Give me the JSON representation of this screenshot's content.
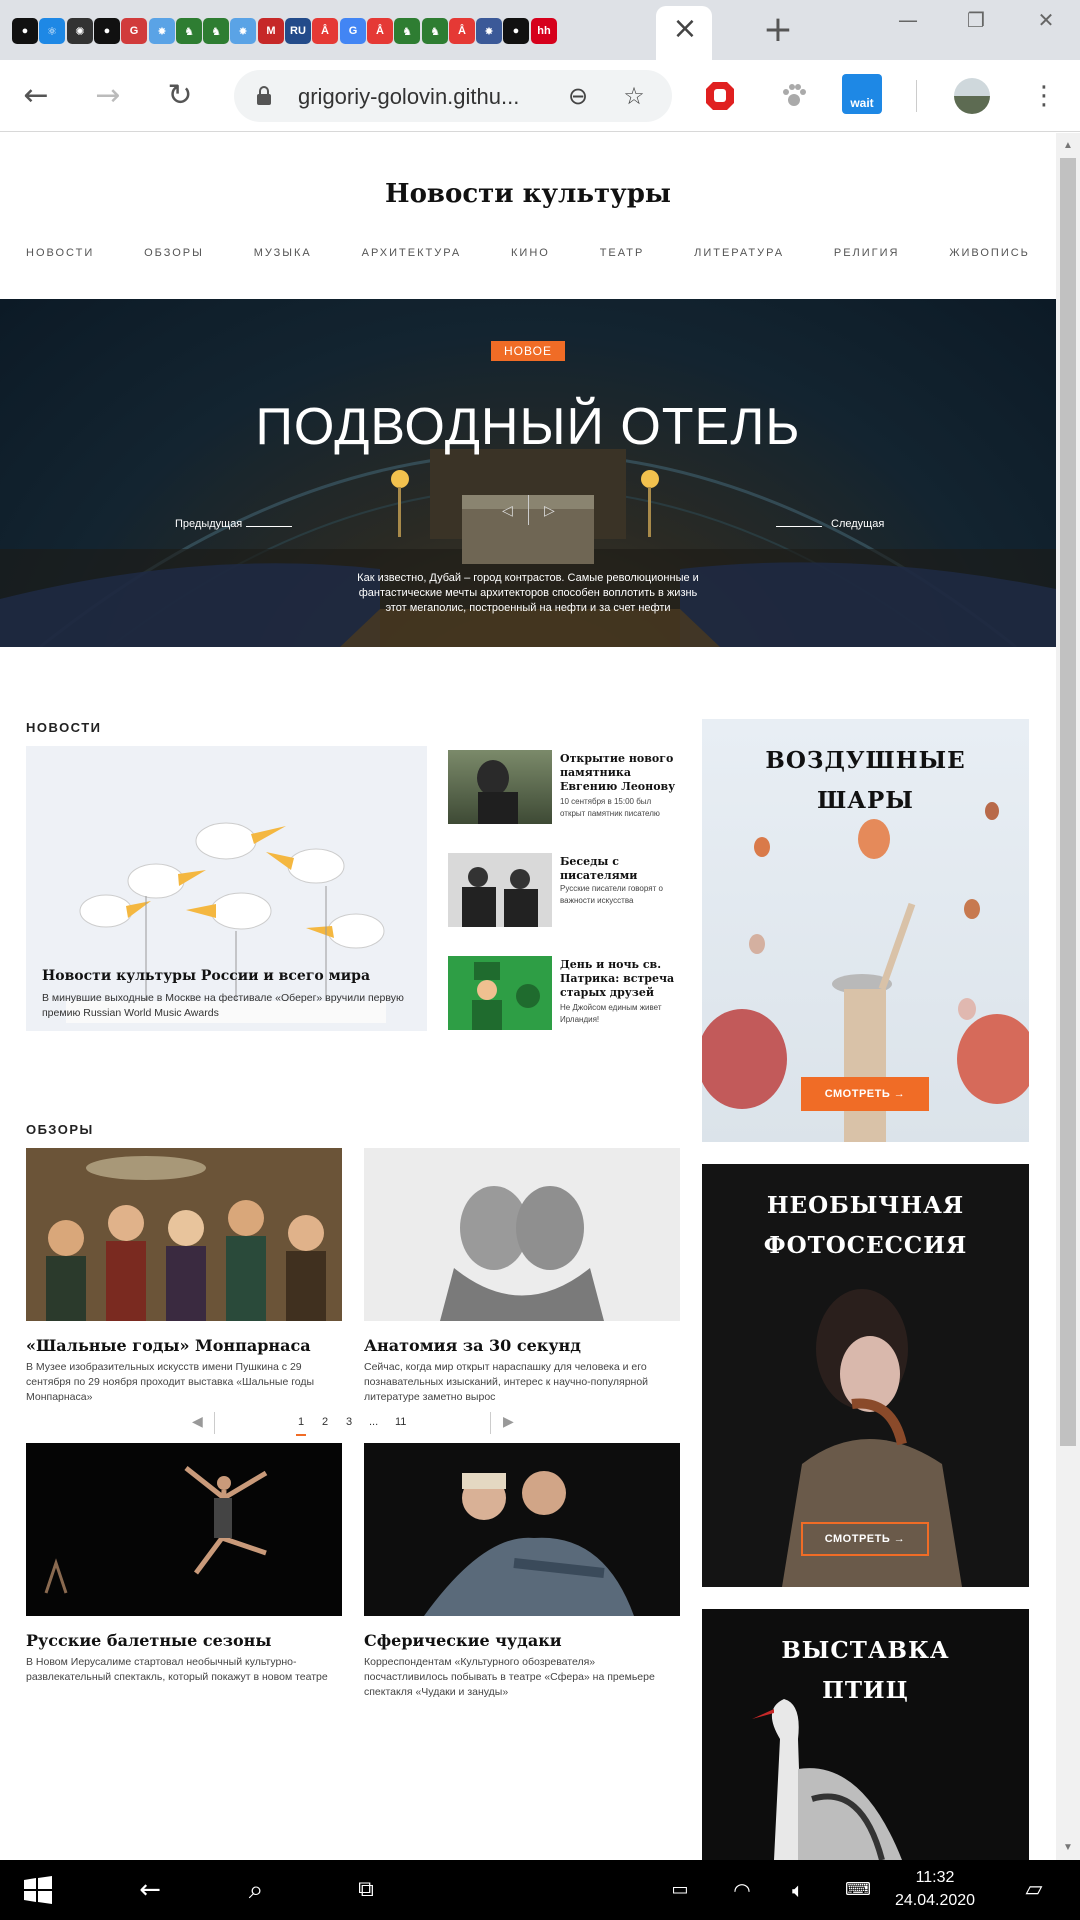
{
  "browser": {
    "tabs": [
      {
        "icon": "github-icon",
        "color": "#111111",
        "glyph": "●"
      },
      {
        "icon": "react-icon",
        "color": "#1e88e5",
        "glyph": "⚛"
      },
      {
        "icon": "openai-icon",
        "color": "#333333",
        "glyph": "✺"
      },
      {
        "icon": "github-icon",
        "color": "#111111",
        "glyph": "●"
      },
      {
        "icon": "gulp-icon",
        "color": "#d13b3b",
        "glyph": "G"
      },
      {
        "icon": "burst-icon",
        "color": "#5aa3e6",
        "glyph": "✸"
      },
      {
        "icon": "android-icon",
        "color": "#2e7d32",
        "glyph": "♞"
      },
      {
        "icon": "android-icon",
        "color": "#2e7d32",
        "glyph": "♞"
      },
      {
        "icon": "burst-icon",
        "color": "#5aa3e6",
        "glyph": "✸"
      },
      {
        "icon": "gmail-icon",
        "color": "#c62828",
        "glyph": "M"
      },
      {
        "icon": "ru-icon",
        "color": "#234b8a",
        "glyph": "RU"
      },
      {
        "icon": "tower-icon",
        "color": "#e53935",
        "glyph": "Å"
      },
      {
        "icon": "translate-icon",
        "color": "#4285f4",
        "glyph": "G"
      },
      {
        "icon": "tower-icon",
        "color": "#e53935",
        "glyph": "Å"
      },
      {
        "icon": "android-icon",
        "color": "#2e7d32",
        "glyph": "♞"
      },
      {
        "icon": "android-icon",
        "color": "#2e7d32",
        "glyph": "♞"
      },
      {
        "icon": "tower-icon",
        "color": "#e53935",
        "glyph": "Å"
      },
      {
        "icon": "burst-icon",
        "color": "#3b5998",
        "glyph": "✸"
      },
      {
        "icon": "github-icon",
        "color": "#111111",
        "glyph": "●"
      },
      {
        "icon": "hh-icon",
        "color": "#d6001c",
        "glyph": "hh"
      }
    ],
    "url": "grigoriy-golovin.githu...",
    "ext_wait_label": "wait"
  },
  "site": {
    "title": "Новости культуры",
    "nav": [
      "НОВОСТИ",
      "ОБЗОРЫ",
      "МУЗЫКА",
      "АРХИТЕКТУРА",
      "КИНО",
      "ТЕАТР",
      "ЛИТЕРАТУРА",
      "РЕЛИГИЯ",
      "ЖИВОПИСЬ"
    ]
  },
  "hero": {
    "badge": "НОВОЕ",
    "title": "ПОДВОДНЫЙ ОТЕЛЬ",
    "prev": "Предыдущая",
    "next": "Следущая",
    "description": "Как известно, Дубай – город контрастов. Самые революционные и фантастические мечты архитекторов способен воплотить в жизнь этот мегаполис, построенный на нефти и за счет нефти"
  },
  "news": {
    "label": "НОВОСТИ",
    "main": {
      "title": "Новости культуры России и всего мира",
      "text": "В минувшие выходные в Москве на фестивале «Оберег» вручили первую премию Russian World Music Awards"
    },
    "items": [
      {
        "title": "Открытие нового памятника Евгению Леонову",
        "text": "10 сентября в 15:00 был открыт памятник писателю"
      },
      {
        "title": "Беседы с писателями",
        "text": "Русские писатели говорят о важности искусства"
      },
      {
        "title": "День и ночь св. Патрика: встреча старых друзей",
        "text": "Не Джойсом единым живет Ирландия!"
      }
    ]
  },
  "reviews": {
    "label": "ОБЗОРЫ",
    "items": [
      {
        "title": "«Шальные годы» Монпарнаса",
        "text": "В Музее изобразительных искусств имени Пушкина с 29 сентября по 29 ноября проходит выставка «Шальные годы Монпарнаса»"
      },
      {
        "title": "Анатомия за 30 секунд",
        "text": "Сейчас, когда мир открыт нараспашку для человека и его познавательных изысканий, интерес к научно-популярной литературе заметно вырос"
      },
      {
        "title": "Русские балетные сезоны",
        "text": "В Новом Иерусалиме стартовал необычный культурно-развлекательный спектакль, который покажут в новом театре"
      },
      {
        "title": "Сферические чудаки",
        "text": "Корреспондентам «Культурного обозревателя» посчастливилось побывать в театре «Сфера» на премьере спектакля «Чудаки и зануды»"
      }
    ]
  },
  "promos": [
    {
      "title_line1": "ВОЗДУШНЫЕ",
      "title_line2": "ШАРЫ",
      "button": "СМОТРЕТЬ →"
    },
    {
      "title_line1": "НЕОБЫЧНАЯ",
      "title_line2": "ФОТОСЕССИЯ",
      "button": "СМОТРЕТЬ →"
    },
    {
      "title_line1": "ВЫСТАВКА",
      "title_line2": "ПТИЦ"
    }
  ],
  "pagination": {
    "pages": [
      "1",
      "2",
      "3",
      "...",
      "11"
    ],
    "current": "1",
    "accent": "#f06c26"
  },
  "taskbar": {
    "time": "11:32",
    "date": "24.04.2020"
  },
  "colors": {
    "accent": "#f06c26"
  }
}
